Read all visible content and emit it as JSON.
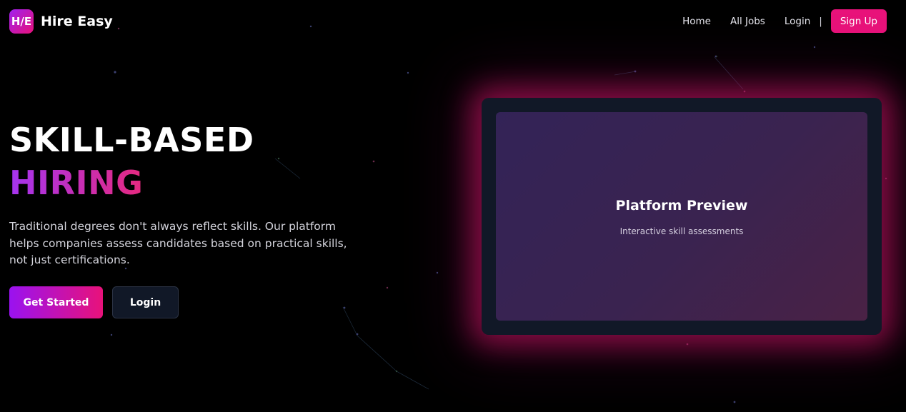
{
  "brand": {
    "logo_text": "H/E",
    "name": "Hire Easy"
  },
  "nav": {
    "home": "Home",
    "all_jobs": "All Jobs",
    "login": "Login",
    "separator": "|",
    "signup": "Sign Up"
  },
  "hero": {
    "title_line1": "SKILL-BASED",
    "title_line2": "HIRING",
    "description": "Traditional degrees don't always reflect skills. Our platform helps companies assess candidates based on practical skills, not just certifications.",
    "primary_button": "Get Started",
    "secondary_button": "Login"
  },
  "preview": {
    "title": "Platform Preview",
    "subtitle": "Interactive skill assessments"
  },
  "colors": {
    "accent_pink": "#e8127a",
    "accent_purple": "#a020f0",
    "background": "#000000",
    "card_bg": "#111827"
  }
}
